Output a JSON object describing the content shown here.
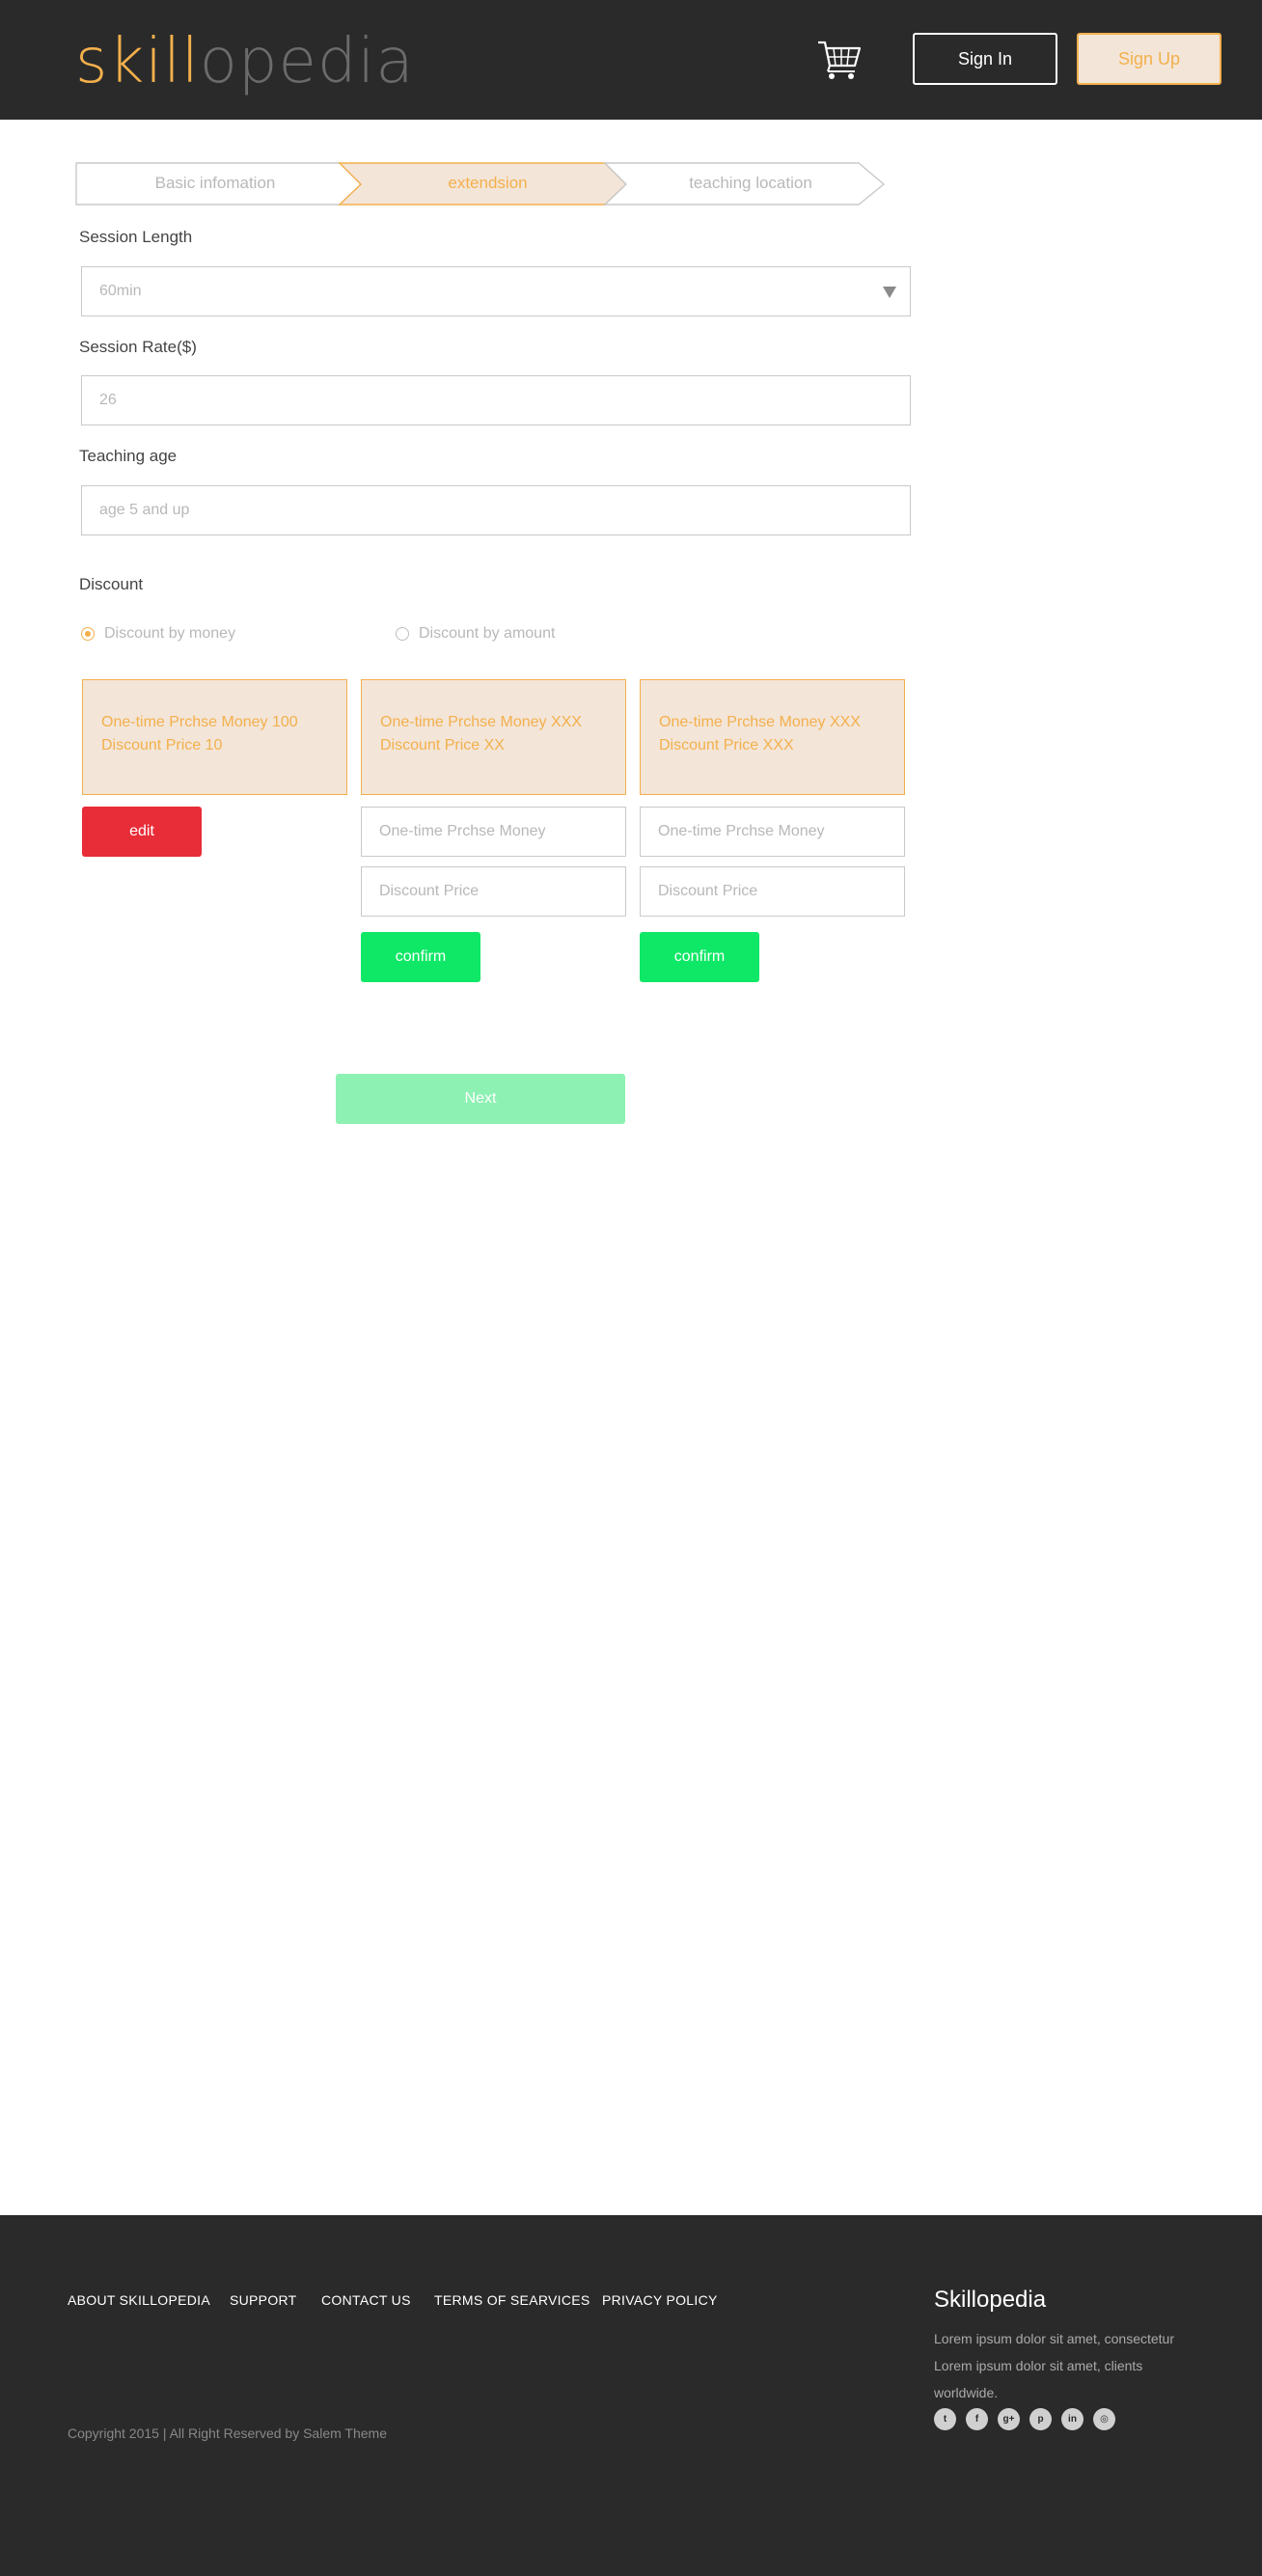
{
  "header": {
    "logo_part1": "skill",
    "logo_part2": "opedia",
    "signin_label": "Sign In",
    "signup_label": "Sign Up",
    "cart_icon": "shopping-cart-icon"
  },
  "steps": [
    {
      "label": "Basic infomation",
      "state": "inactive"
    },
    {
      "label": "extendsion",
      "state": "active"
    },
    {
      "label": "teaching location",
      "state": "inactive"
    }
  ],
  "form": {
    "session_length": {
      "label": "Session Length",
      "value": "60min"
    },
    "session_rate": {
      "label": "Session Rate($)",
      "placeholder": "26"
    },
    "teaching_age": {
      "label": "Teaching age",
      "placeholder": "age 5 and up"
    },
    "discount": {
      "label": "Discount",
      "options": [
        {
          "label": "Discount by money",
          "selected": true
        },
        {
          "label": "Discount by amount",
          "selected": false
        }
      ],
      "cards": [
        {
          "line1": "One-time Prchse Money 100",
          "line2": "Discount Price 10"
        },
        {
          "line1": "One-time Prchse Money XXX",
          "line2": "Discount Price XX"
        },
        {
          "line1": "One-time Prchse Money XXX",
          "line2": "Discount Price XXX"
        }
      ],
      "money_placeholder": "One-time Prchse Money",
      "price_placeholder": "Discount Price",
      "edit_label": "edit",
      "confirm_label": "confirm"
    },
    "next_label": "Next"
  },
  "footer": {
    "nav": [
      "ABOUT SKILLOPEDIA",
      "SUPPORT",
      "CONTACT US",
      "TERMS OF SEARVICES",
      "PRIVACY POLICY"
    ],
    "copyright": "Copyright 2015 | All Right Reserved by Salem Theme",
    "brand_title": "Skillopedia",
    "brand_desc": "Lorem ipsum dolor sit amet, consectetur Lorem ipsum dolor sit amet,  clients worldwide.",
    "socials": [
      {
        "icon": "twitter-icon",
        "glyph": "t"
      },
      {
        "icon": "facebook-icon",
        "glyph": "f"
      },
      {
        "icon": "google-plus-icon",
        "glyph": "g+"
      },
      {
        "icon": "pinterest-icon",
        "glyph": "p"
      },
      {
        "icon": "linkedin-icon",
        "glyph": "in"
      },
      {
        "icon": "dribbble-icon",
        "glyph": "◎"
      }
    ]
  },
  "colors": {
    "accent": "#f3b04c",
    "header_bg": "#2a2a2a",
    "edit": "#e82c38",
    "confirm": "#0fe866",
    "next": "#8df1b3"
  }
}
